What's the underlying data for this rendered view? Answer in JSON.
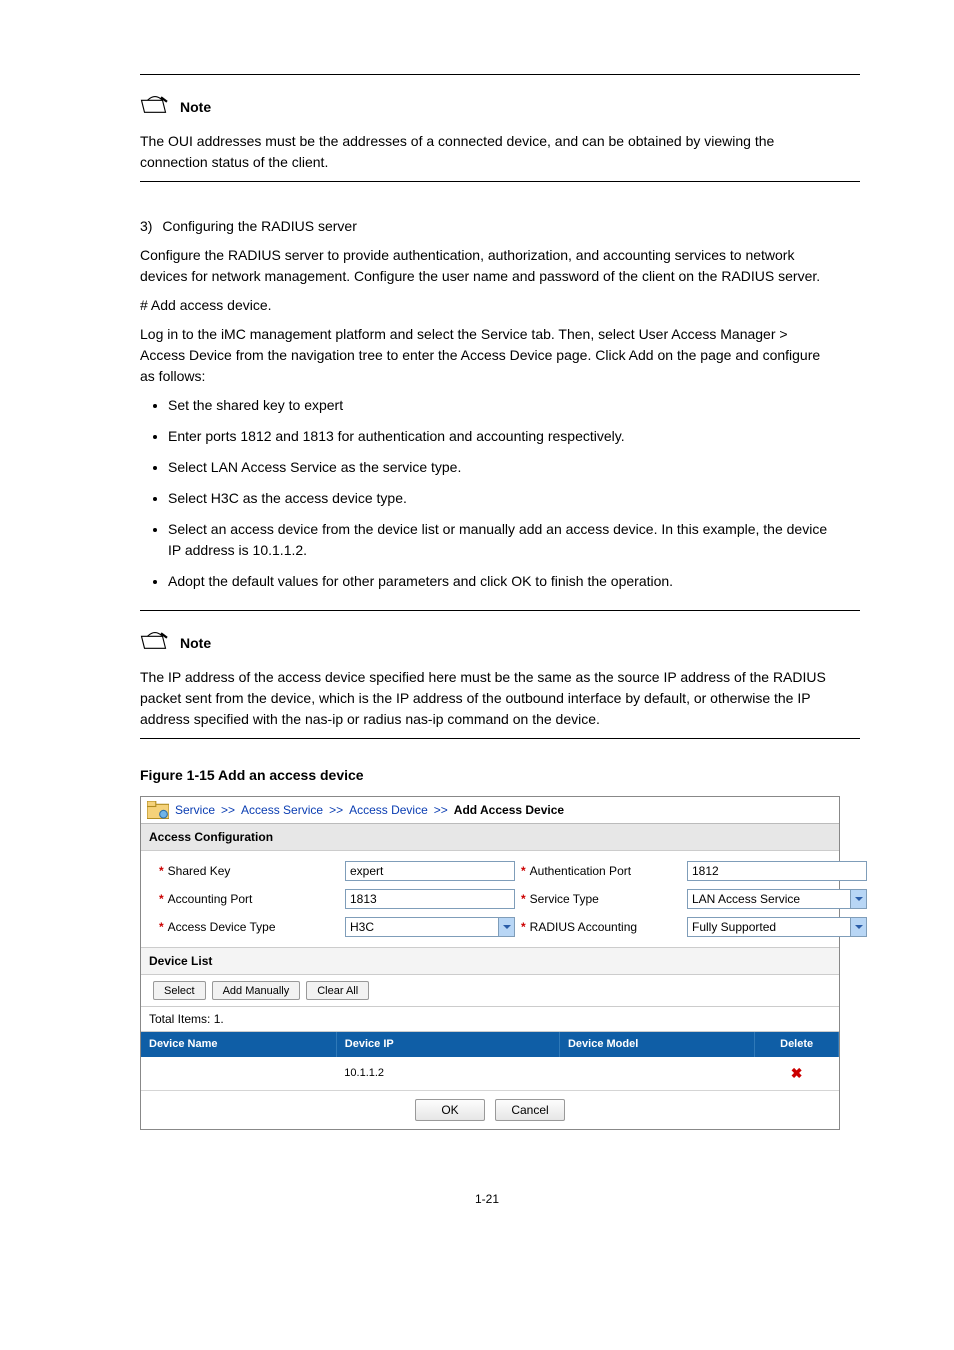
{
  "note_label": "Note",
  "note1_text": "The OUI addresses must be the addresses of a connected device, and can be obtained by viewing the connection status of the client.",
  "section3": {
    "heading": "3)",
    "title": "Configuring the RADIUS server",
    "intro": "Configure the RADIUS server to provide authentication, authorization, and accounting services to network devices for network management. Configure the user name and password of the client on the RADIUS server.",
    "step1_prefix": "# ",
    "step1_title": "Add access device.",
    "step1_body": "Log in to the iMC management platform and select the Service tab. Then, select User Access Manager > Access Device from the navigation tree to enter the Access Device page. Click Add on the page and configure as follows:",
    "bullets": [
      "Set the shared key to expert",
      "Enter ports 1812 and 1813 for authentication and accounting respectively.",
      "Select LAN Access Service as the service type.",
      "Select H3C as the access device type.",
      "Select an access device from the device list or manually add an access device. In this example, the device IP address is 10.1.1.2.",
      "Adopt the default values for other parameters and click OK to finish the operation."
    ]
  },
  "note2_text": "The IP address of the access device specified here must be the same as the source IP address of the RADIUS packet sent from the device, which is the IP address of the outbound interface by default, or otherwise the IP address specified with the nas-ip or radius nas-ip command on the device.",
  "figure_label": "Figure 1-15 Add an access device",
  "shot": {
    "breadcrumb": {
      "items": [
        "Service",
        "Access Service",
        "Access Device"
      ],
      "current": "Add Access Device"
    },
    "access_config_title": "Access Configuration",
    "fields": {
      "shared_key_label": "Shared Key",
      "shared_key_value": "expert",
      "auth_port_label": "Authentication Port",
      "auth_port_value": "1812",
      "acct_port_label": "Accounting Port",
      "acct_port_value": "1813",
      "service_type_label": "Service Type",
      "service_type_value": "LAN Access Service",
      "dev_type_label": "Access Device Type",
      "dev_type_value": "H3C",
      "radius_acct_label": "RADIUS Accounting",
      "radius_acct_value": "Fully Supported"
    },
    "device_list_title": "Device List",
    "buttons": {
      "select": "Select",
      "add_manually": "Add Manually",
      "clear_all": "Clear All"
    },
    "total_items": "Total Items: 1.",
    "columns": {
      "c1": "Device Name",
      "c2": "Device IP",
      "c3": "Device Model",
      "c4": "Delete"
    },
    "row": {
      "ip": "10.1.1.2"
    },
    "ok_label": "OK",
    "cancel_label": "Cancel"
  },
  "pagenum": "1-21"
}
